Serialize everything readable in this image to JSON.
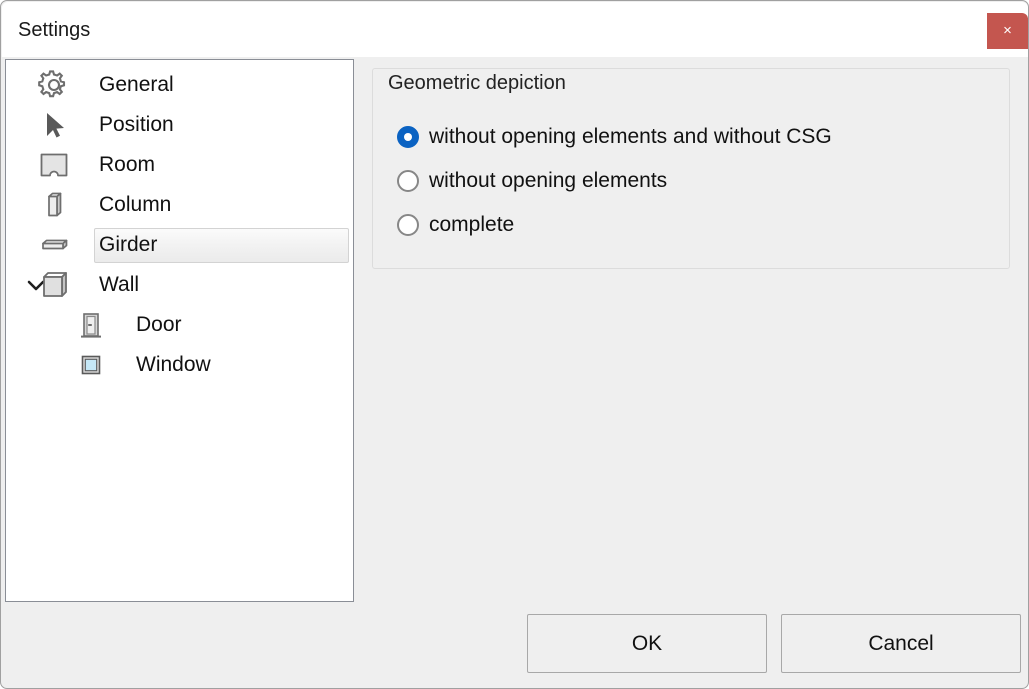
{
  "window": {
    "title": "Settings",
    "close_label": "×",
    "close_icon": "close-icon",
    "accent_close_bg": "#c4564f",
    "background": "#efefef"
  },
  "sidebar": {
    "items": [
      {
        "label": "General",
        "icon": "gear-icon",
        "depth": 0,
        "expander": "",
        "selected": false
      },
      {
        "label": "Position",
        "icon": "cursor-arrow-icon",
        "depth": 0,
        "expander": "",
        "selected": false
      },
      {
        "label": "Room",
        "icon": "room-icon",
        "depth": 0,
        "expander": "",
        "selected": false
      },
      {
        "label": "Column",
        "icon": "column-icon",
        "depth": 0,
        "expander": "",
        "selected": false
      },
      {
        "label": "Girder",
        "icon": "girder-icon",
        "depth": 0,
        "expander": "",
        "selected": true
      },
      {
        "label": "Wall",
        "icon": "wall-icon",
        "depth": 0,
        "expander": "chevron-down-icon",
        "selected": false
      },
      {
        "label": "Door",
        "icon": "door-icon",
        "depth": 1,
        "expander": "",
        "selected": false
      },
      {
        "label": "Window",
        "icon": "window-icon",
        "depth": 1,
        "expander": "",
        "selected": false
      }
    ]
  },
  "main": {
    "group_title": "Geometric depiction",
    "radio_options": [
      {
        "label": "without opening elements and without CSG",
        "selected": true
      },
      {
        "label": "without opening elements",
        "selected": false
      },
      {
        "label": "complete",
        "selected": false
      }
    ],
    "selected_color": "#0a62c2"
  },
  "footer": {
    "ok_label": "OK",
    "cancel_label": "Cancel"
  }
}
